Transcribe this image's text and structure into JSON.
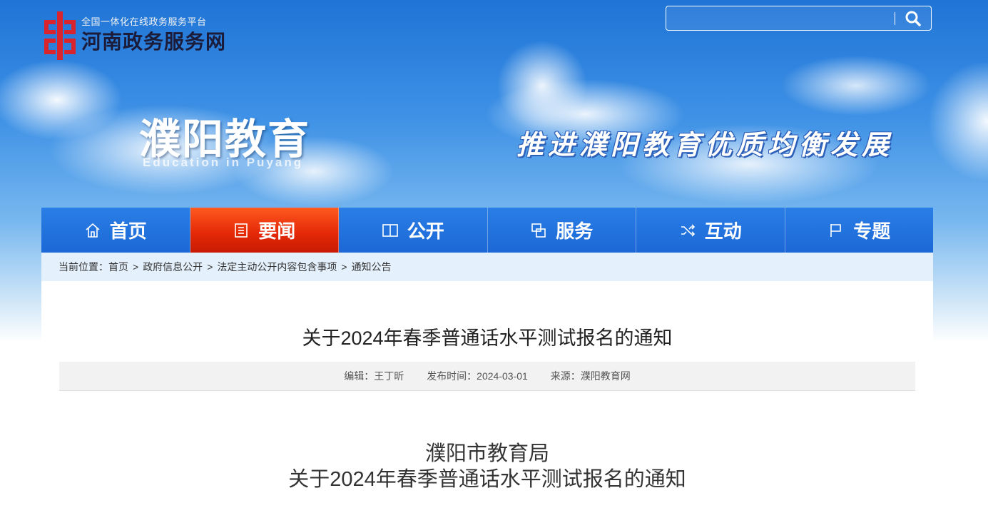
{
  "header": {
    "logo_subtitle": "全国一体化在线政务服务平台",
    "logo_title": "河南政务服务网",
    "site_title": "濮阳教育",
    "site_title_en": "Education in Puyang",
    "slogan": "推进濮阳教育优质均衡发展"
  },
  "search": {
    "value": "",
    "placeholder": "",
    "icon": "search-icon"
  },
  "nav": {
    "items": [
      {
        "label": "首页",
        "icon": "home-icon",
        "active": false
      },
      {
        "label": "要闻",
        "icon": "news-icon",
        "active": true
      },
      {
        "label": "公开",
        "icon": "book-icon",
        "active": false
      },
      {
        "label": "服务",
        "icon": "service-icon",
        "active": false
      },
      {
        "label": "互动",
        "icon": "shuffle-icon",
        "active": false
      },
      {
        "label": "专题",
        "icon": "flag-icon",
        "active": false
      }
    ]
  },
  "breadcrumb": {
    "prefix": "当前位置：",
    "items": [
      "首页",
      "政府信息公开",
      "法定主动公开内容包含事项",
      "通知公告"
    ],
    "separator": ">"
  },
  "article": {
    "title": "关于2024年春季普通话水平测试报名的通知",
    "editor": "编辑：王丁昕",
    "publish_time": "发布时间：2024-03-01",
    "source": "来源：濮阳教育网",
    "doc_org": "濮阳市教育局",
    "doc_title": "关于2024年春季普通话水平测试报名的通知"
  },
  "colors": {
    "nav_blue": "#1e6fdc",
    "nav_active_red": "#e52a08",
    "breadcrumb_bg": "#e4f0fb",
    "logo_red": "#d9232d"
  }
}
